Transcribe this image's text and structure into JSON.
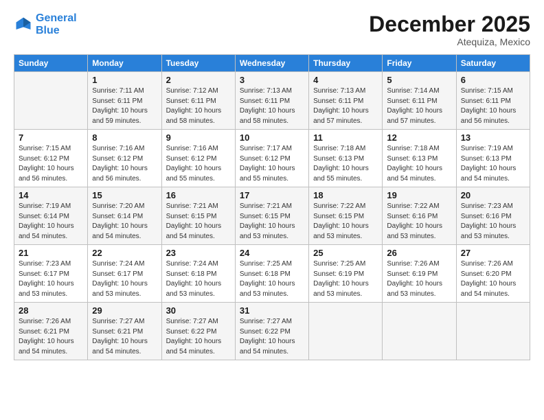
{
  "logo": {
    "line1": "General",
    "line2": "Blue"
  },
  "title": "December 2025",
  "subtitle": "Atequiza, Mexico",
  "days_header": [
    "Sunday",
    "Monday",
    "Tuesday",
    "Wednesday",
    "Thursday",
    "Friday",
    "Saturday"
  ],
  "weeks": [
    [
      {
        "day": "",
        "sunrise": "",
        "sunset": "",
        "daylight": ""
      },
      {
        "day": "1",
        "sunrise": "Sunrise: 7:11 AM",
        "sunset": "Sunset: 6:11 PM",
        "daylight": "Daylight: 10 hours and 59 minutes."
      },
      {
        "day": "2",
        "sunrise": "Sunrise: 7:12 AM",
        "sunset": "Sunset: 6:11 PM",
        "daylight": "Daylight: 10 hours and 58 minutes."
      },
      {
        "day": "3",
        "sunrise": "Sunrise: 7:13 AM",
        "sunset": "Sunset: 6:11 PM",
        "daylight": "Daylight: 10 hours and 58 minutes."
      },
      {
        "day": "4",
        "sunrise": "Sunrise: 7:13 AM",
        "sunset": "Sunset: 6:11 PM",
        "daylight": "Daylight: 10 hours and 57 minutes."
      },
      {
        "day": "5",
        "sunrise": "Sunrise: 7:14 AM",
        "sunset": "Sunset: 6:11 PM",
        "daylight": "Daylight: 10 hours and 57 minutes."
      },
      {
        "day": "6",
        "sunrise": "Sunrise: 7:15 AM",
        "sunset": "Sunset: 6:11 PM",
        "daylight": "Daylight: 10 hours and 56 minutes."
      }
    ],
    [
      {
        "day": "7",
        "sunrise": "Sunrise: 7:15 AM",
        "sunset": "Sunset: 6:12 PM",
        "daylight": "Daylight: 10 hours and 56 minutes."
      },
      {
        "day": "8",
        "sunrise": "Sunrise: 7:16 AM",
        "sunset": "Sunset: 6:12 PM",
        "daylight": "Daylight: 10 hours and 56 minutes."
      },
      {
        "day": "9",
        "sunrise": "Sunrise: 7:16 AM",
        "sunset": "Sunset: 6:12 PM",
        "daylight": "Daylight: 10 hours and 55 minutes."
      },
      {
        "day": "10",
        "sunrise": "Sunrise: 7:17 AM",
        "sunset": "Sunset: 6:12 PM",
        "daylight": "Daylight: 10 hours and 55 minutes."
      },
      {
        "day": "11",
        "sunrise": "Sunrise: 7:18 AM",
        "sunset": "Sunset: 6:13 PM",
        "daylight": "Daylight: 10 hours and 55 minutes."
      },
      {
        "day": "12",
        "sunrise": "Sunrise: 7:18 AM",
        "sunset": "Sunset: 6:13 PM",
        "daylight": "Daylight: 10 hours and 54 minutes."
      },
      {
        "day": "13",
        "sunrise": "Sunrise: 7:19 AM",
        "sunset": "Sunset: 6:13 PM",
        "daylight": "Daylight: 10 hours and 54 minutes."
      }
    ],
    [
      {
        "day": "14",
        "sunrise": "Sunrise: 7:19 AM",
        "sunset": "Sunset: 6:14 PM",
        "daylight": "Daylight: 10 hours and 54 minutes."
      },
      {
        "day": "15",
        "sunrise": "Sunrise: 7:20 AM",
        "sunset": "Sunset: 6:14 PM",
        "daylight": "Daylight: 10 hours and 54 minutes."
      },
      {
        "day": "16",
        "sunrise": "Sunrise: 7:21 AM",
        "sunset": "Sunset: 6:15 PM",
        "daylight": "Daylight: 10 hours and 54 minutes."
      },
      {
        "day": "17",
        "sunrise": "Sunrise: 7:21 AM",
        "sunset": "Sunset: 6:15 PM",
        "daylight": "Daylight: 10 hours and 53 minutes."
      },
      {
        "day": "18",
        "sunrise": "Sunrise: 7:22 AM",
        "sunset": "Sunset: 6:15 PM",
        "daylight": "Daylight: 10 hours and 53 minutes."
      },
      {
        "day": "19",
        "sunrise": "Sunrise: 7:22 AM",
        "sunset": "Sunset: 6:16 PM",
        "daylight": "Daylight: 10 hours and 53 minutes."
      },
      {
        "day": "20",
        "sunrise": "Sunrise: 7:23 AM",
        "sunset": "Sunset: 6:16 PM",
        "daylight": "Daylight: 10 hours and 53 minutes."
      }
    ],
    [
      {
        "day": "21",
        "sunrise": "Sunrise: 7:23 AM",
        "sunset": "Sunset: 6:17 PM",
        "daylight": "Daylight: 10 hours and 53 minutes."
      },
      {
        "day": "22",
        "sunrise": "Sunrise: 7:24 AM",
        "sunset": "Sunset: 6:17 PM",
        "daylight": "Daylight: 10 hours and 53 minutes."
      },
      {
        "day": "23",
        "sunrise": "Sunrise: 7:24 AM",
        "sunset": "Sunset: 6:18 PM",
        "daylight": "Daylight: 10 hours and 53 minutes."
      },
      {
        "day": "24",
        "sunrise": "Sunrise: 7:25 AM",
        "sunset": "Sunset: 6:18 PM",
        "daylight": "Daylight: 10 hours and 53 minutes."
      },
      {
        "day": "25",
        "sunrise": "Sunrise: 7:25 AM",
        "sunset": "Sunset: 6:19 PM",
        "daylight": "Daylight: 10 hours and 53 minutes."
      },
      {
        "day": "26",
        "sunrise": "Sunrise: 7:26 AM",
        "sunset": "Sunset: 6:19 PM",
        "daylight": "Daylight: 10 hours and 53 minutes."
      },
      {
        "day": "27",
        "sunrise": "Sunrise: 7:26 AM",
        "sunset": "Sunset: 6:20 PM",
        "daylight": "Daylight: 10 hours and 54 minutes."
      }
    ],
    [
      {
        "day": "28",
        "sunrise": "Sunrise: 7:26 AM",
        "sunset": "Sunset: 6:21 PM",
        "daylight": "Daylight: 10 hours and 54 minutes."
      },
      {
        "day": "29",
        "sunrise": "Sunrise: 7:27 AM",
        "sunset": "Sunset: 6:21 PM",
        "daylight": "Daylight: 10 hours and 54 minutes."
      },
      {
        "day": "30",
        "sunrise": "Sunrise: 7:27 AM",
        "sunset": "Sunset: 6:22 PM",
        "daylight": "Daylight: 10 hours and 54 minutes."
      },
      {
        "day": "31",
        "sunrise": "Sunrise: 7:27 AM",
        "sunset": "Sunset: 6:22 PM",
        "daylight": "Daylight: 10 hours and 54 minutes."
      },
      {
        "day": "",
        "sunrise": "",
        "sunset": "",
        "daylight": ""
      },
      {
        "day": "",
        "sunrise": "",
        "sunset": "",
        "daylight": ""
      },
      {
        "day": "",
        "sunrise": "",
        "sunset": "",
        "daylight": ""
      }
    ]
  ]
}
